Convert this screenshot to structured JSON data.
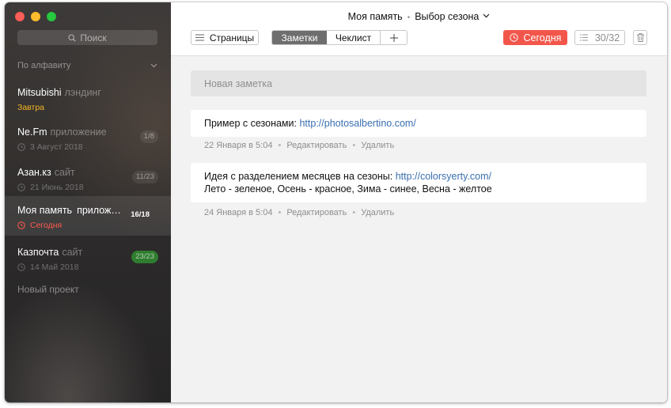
{
  "sidebar": {
    "search_placeholder": "Поиск",
    "sort_label": "По алфавиту",
    "projects": [
      {
        "name": "Mitsubishi",
        "type": "лэндинг",
        "date": "Завтра",
        "badge": ""
      },
      {
        "name": "Ne.Fm",
        "type": "приложение",
        "date": "3 Август 2018",
        "badge": "1/8"
      },
      {
        "name": "Азан.кз",
        "type": "сайт",
        "date": "21 Июнь 2018",
        "badge": "11/23"
      },
      {
        "name": "Моя память",
        "type": "прилож…",
        "date": "Сегодня",
        "badge": "16/18"
      },
      {
        "name": "Казпочта",
        "type": "сайт",
        "date": "14 Май 2018",
        "badge": "23/23"
      }
    ],
    "new_project": "Новый проект"
  },
  "header": {
    "project": "Моя память",
    "separator": "•",
    "page": "Выбор сезона",
    "pages_button": "Страницы",
    "tab_notes": "Заметки",
    "tab_checklist": "Чеклист",
    "today_button": "Сегодня",
    "task_count": "30/32"
  },
  "main": {
    "new_note_placeholder": "Новая заметка",
    "notes": [
      {
        "text": "Пример с сезонами: ",
        "link": "http://photosalbertino.com/",
        "line2": "",
        "date": "22 Января в 5:04",
        "edit": "Редактировать",
        "delete": "Удалить"
      },
      {
        "text": "Идея с разделением месяцев на сезоны: ",
        "link": "http://colorsyerty.com/",
        "line2": "Лето - зеленое, Осень - красное, Зима - синее, Весна - желтое",
        "date": "24 Января в 5:04",
        "edit": "Редактировать",
        "delete": "Удалить"
      }
    ],
    "meta_separator": "•"
  },
  "colors": {
    "accent_red": "#f2564b",
    "link_blue": "#3a6fb0",
    "tomorrow_yellow": "#f5b525",
    "done_green": "#2f7d2f"
  }
}
